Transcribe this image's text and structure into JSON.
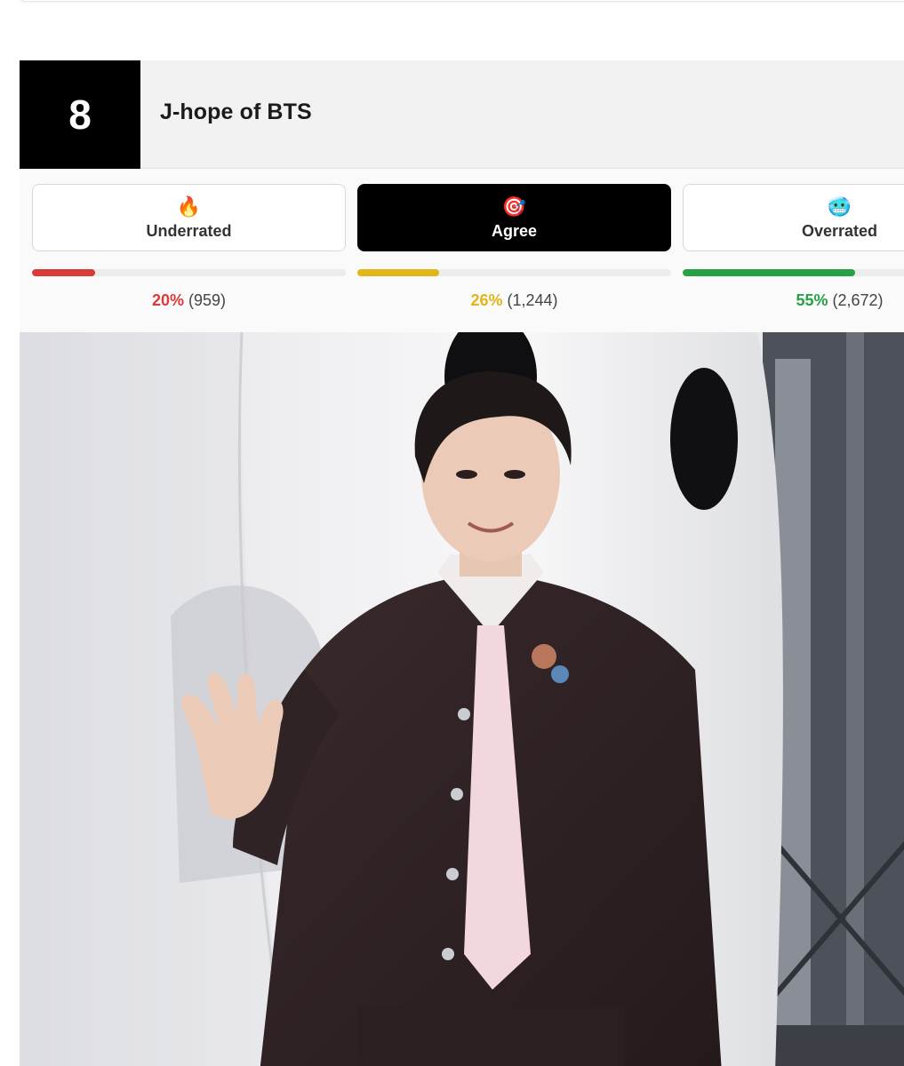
{
  "item": {
    "rank": "8",
    "title": "J-hope of BTS"
  },
  "votes": [
    {
      "id": "underrated",
      "label": "Underrated",
      "emoji": "🔥",
      "percent_text": "20%",
      "count_text": "(959)",
      "fill": 0.2,
      "color": "#d93a3a",
      "active": false
    },
    {
      "id": "agree",
      "label": "Agree",
      "emoji": "🎯",
      "percent_text": "26%",
      "count_text": "(1,244)",
      "fill": 0.26,
      "color": "#e2b519",
      "active": true
    },
    {
      "id": "overrated",
      "label": "Overrated",
      "emoji": "🥶",
      "percent_text": "55%",
      "count_text": "(2,672)",
      "fill": 0.55,
      "color": "#27a145",
      "active": false
    }
  ],
  "photo": {
    "subject": "person-in-dark-suit-waving"
  }
}
